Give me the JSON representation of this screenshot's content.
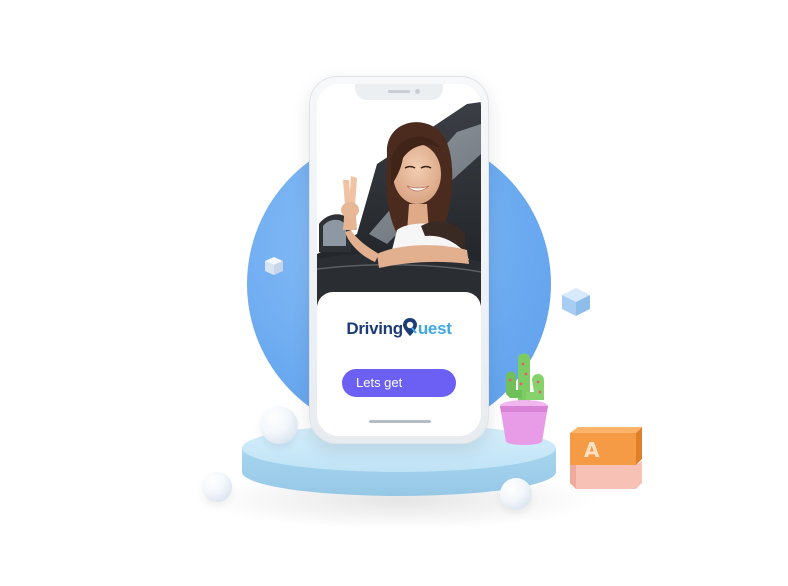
{
  "app": {
    "logo_part1": "Driving",
    "logo_part2": "uest",
    "cta_label": "Lets get"
  },
  "decor": {
    "block_letter": "A"
  },
  "colors": {
    "background_circle": "#6aa9f0",
    "cta_button": "#6c60f4",
    "logo_primary": "#1d3c78",
    "logo_accent": "#3da8e4",
    "pedestal": "#bfe3f6",
    "cactus": "#7ccb63",
    "pot": "#e89be6",
    "block_top": "#f59a45",
    "block_bottom": "#f7c2b5"
  },
  "icons": [
    "map-pin-icon"
  ]
}
